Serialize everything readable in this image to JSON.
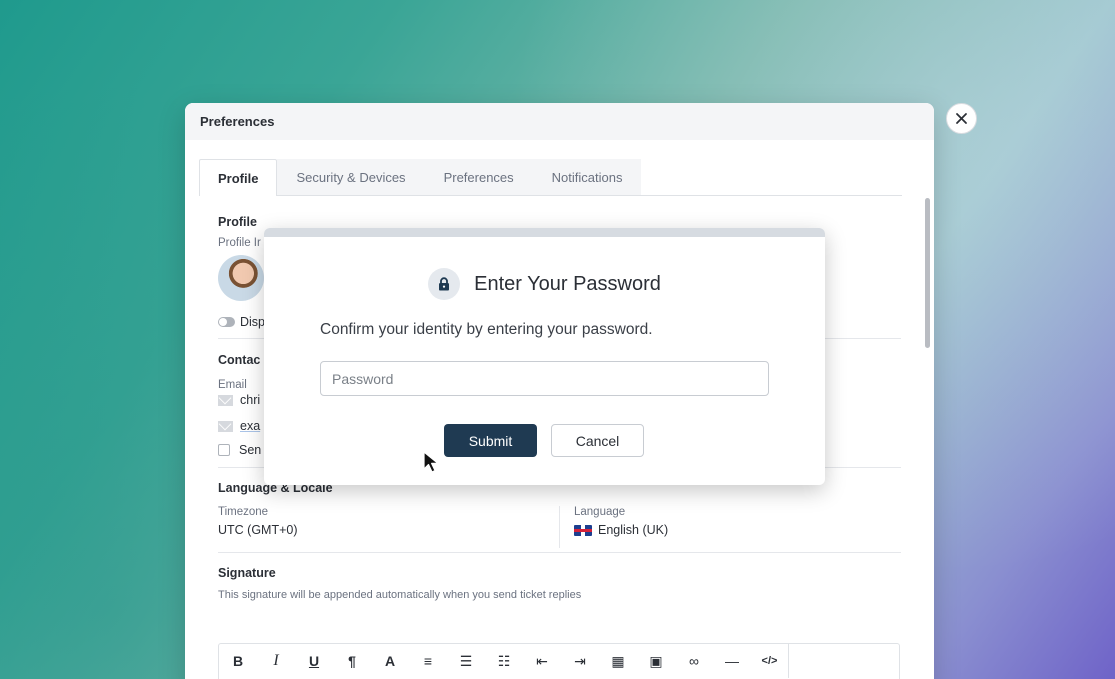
{
  "window": {
    "title": "Preferences"
  },
  "tabs": [
    {
      "label": "Profile",
      "active": true
    },
    {
      "label": "Security & Devices",
      "active": false
    },
    {
      "label": "Preferences",
      "active": false
    },
    {
      "label": "Notifications",
      "active": false
    }
  ],
  "profile": {
    "section_title": "Profile",
    "image_label": "Profile Ir",
    "toggle_label": "Disp"
  },
  "contact": {
    "section_title": "Contac",
    "email_label": "Email",
    "emails": [
      "chri",
      "exa"
    ],
    "checkbox_label": "Sen"
  },
  "locale": {
    "section_title": "Language & Locale",
    "timezone_label": "Timezone",
    "timezone_value": "UTC (GMT+0)",
    "language_label": "Language",
    "language_value": "English (UK)"
  },
  "signature": {
    "section_title": "Signature",
    "description": "This signature will be appended automatically when you send ticket replies",
    "toolbar_icons": [
      "bold-icon",
      "italic-icon",
      "underline-icon",
      "paragraph-icon",
      "font-color-icon",
      "align-left-icon",
      "bullet-list-icon",
      "numbered-list-icon",
      "outdent-icon",
      "indent-icon",
      "table-icon",
      "image-icon",
      "link-icon",
      "horizontal-rule-icon",
      "code-icon"
    ]
  },
  "modal": {
    "title": "Enter Your Password",
    "description": "Confirm your identity by entering your password.",
    "password_placeholder": "Password",
    "password_value": "",
    "submit_label": "Submit",
    "cancel_label": "Cancel"
  },
  "colors": {
    "primary_button": "#1f3a52",
    "background_start": "#1f9a8d",
    "background_end": "#6f63c8"
  }
}
